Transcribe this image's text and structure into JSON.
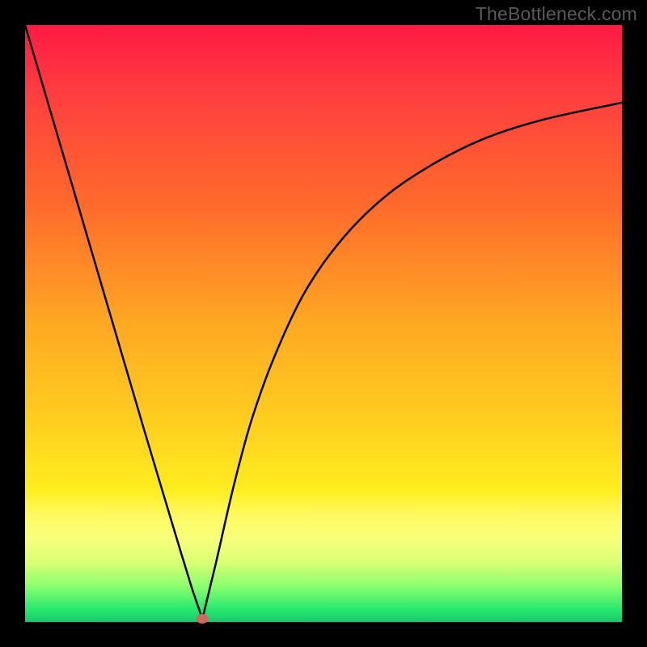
{
  "watermark": "TheBottleneck.com",
  "colors": {
    "curve": "#000000",
    "dot": "#cf6a5a",
    "frame": "#000000"
  },
  "chart_data": {
    "type": "line",
    "title": "",
    "xlabel": "",
    "ylabel": "",
    "xlim": [
      0,
      1
    ],
    "ylim": [
      0,
      1
    ],
    "grid": false,
    "legend": false,
    "annotations": [
      "TheBottleneck.com"
    ],
    "series": [
      {
        "name": "bottleneck-curve-left",
        "x": [
          0.0,
          0.05,
          0.1,
          0.15,
          0.2,
          0.23,
          0.26,
          0.28,
          0.297
        ],
        "y": [
          1.0,
          0.83,
          0.66,
          0.49,
          0.32,
          0.22,
          0.12,
          0.055,
          0.005
        ]
      },
      {
        "name": "bottleneck-curve-right",
        "x": [
          0.297,
          0.32,
          0.35,
          0.38,
          0.42,
          0.47,
          0.53,
          0.6,
          0.68,
          0.77,
          0.87,
          1.0
        ],
        "y": [
          0.005,
          0.1,
          0.23,
          0.34,
          0.45,
          0.555,
          0.64,
          0.71,
          0.765,
          0.81,
          0.842,
          0.87
        ]
      }
    ],
    "minimum_point": {
      "x": 0.297,
      "y": 0.005
    }
  }
}
